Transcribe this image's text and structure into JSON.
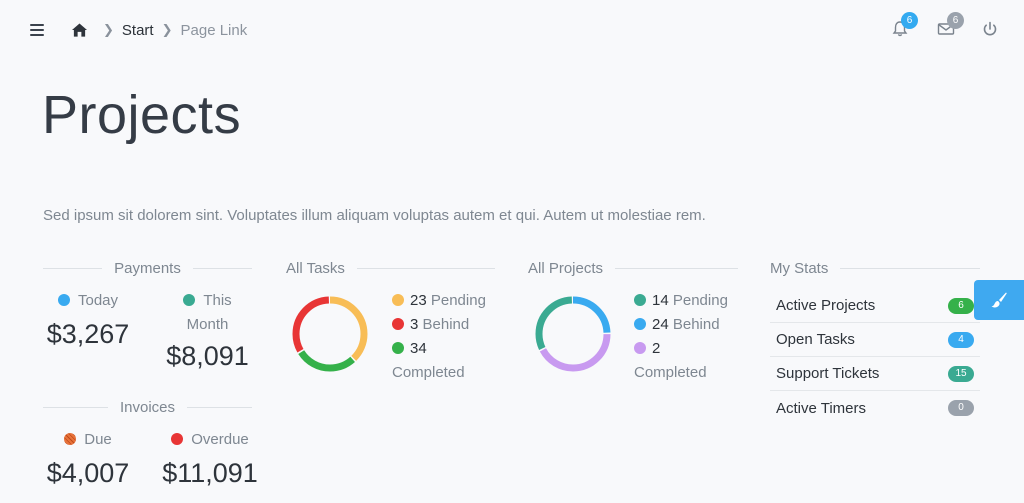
{
  "topbar": {
    "breadcrumb": {
      "start": "Start",
      "page": "Page Link"
    },
    "notifications_count": "6",
    "messages_count": "6",
    "icons": {
      "menu": "hamburger-icon",
      "home": "home-icon",
      "bell": "bell-icon",
      "mail": "mail-icon",
      "power": "power-icon",
      "brush": "paintbrush-icon"
    }
  },
  "page": {
    "title": "Projects",
    "description": "Sed ipsum sit dolorem sint. Voluptates illum aliquam voluptas autem et qui. Autem ut molestiae rem."
  },
  "payments": {
    "header": "Payments",
    "today": {
      "label": "Today",
      "value": "$3,267",
      "color": "#39aaf0"
    },
    "month": {
      "label_a": "This",
      "label_b": "Month",
      "value": "$8,091",
      "color": "#3aaa92"
    }
  },
  "invoices": {
    "header": "Invoices",
    "due": {
      "label": "Due",
      "value": "$4,007",
      "color": "#e8733a"
    },
    "overdue": {
      "label": "Overdue",
      "value": "$11,091",
      "color": "#e83535"
    }
  },
  "all_tasks": {
    "header": "All Tasks",
    "items": [
      {
        "num": "23",
        "label": "Pending",
        "value": 23,
        "color": "#f8bd56"
      },
      {
        "num": "3",
        "label": "Behind",
        "value": 3,
        "color": "#e83535"
      },
      {
        "num": "34",
        "label": "Completed",
        "value": 34,
        "color": "#35b14a"
      }
    ],
    "donut_segments": [
      {
        "value": 23,
        "color": "#f8bd56"
      },
      {
        "value": 17,
        "color": "#35b14a"
      },
      {
        "value": 20,
        "color": "#e83535"
      }
    ]
  },
  "all_projects": {
    "header": "All Projects",
    "items": [
      {
        "num": "14",
        "label": "Pending",
        "value": 14,
        "color": "#3aaa92"
      },
      {
        "num": "24",
        "label": "Behind",
        "value": 24,
        "color": "#39aaf0"
      },
      {
        "num": "2",
        "label": "Completed",
        "value": 2,
        "color": "#c89af0"
      }
    ],
    "donut_segments": [
      {
        "value": 14,
        "color": "#39aaf0"
      },
      {
        "value": 24,
        "color": "#c89af0"
      },
      {
        "value": 18,
        "color": "#3aaa92"
      }
    ]
  },
  "my_stats": {
    "header": "My Stats",
    "rows": [
      {
        "label": "Active Projects",
        "count": "6",
        "color": "#35b14a"
      },
      {
        "label": "Open Tasks",
        "count": "4",
        "color": "#39aaf0"
      },
      {
        "label": "Support Tickets",
        "count": "15",
        "color": "#3aaa92"
      },
      {
        "label": "Active Timers",
        "count": "0",
        "color": "#9aa2ac"
      }
    ]
  }
}
